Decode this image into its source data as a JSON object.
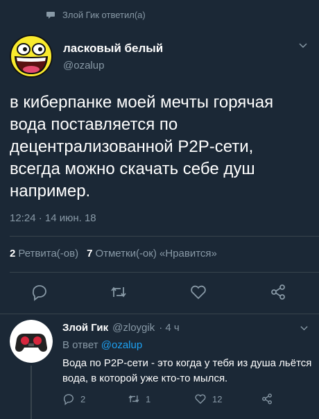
{
  "context": {
    "text": "Злой Гик ответил(а)",
    "icon": "comment-icon"
  },
  "main_tweet": {
    "display_name": "ласковый белый",
    "handle": "@ozalup",
    "text": "в киберпанке моей мечты горячая вода поставляется по децентрализованной P2P-сети, всегда можно скачать себе душ например.",
    "timestamp": "12:24 · 14 июн. 18",
    "retweets_count": "2",
    "retweets_label": "Ретвита(-ов)",
    "likes_count": "7",
    "likes_label": "Отметки(-ок) «Нравится»"
  },
  "reply": {
    "display_name": "Злой Гик",
    "handle": "@zloygik",
    "time": "· 4 ч",
    "reply_to_prefix": "В ответ",
    "reply_to_handle": "@ozalup",
    "text": "Вода по P2P-сети - это когда у тебя из душа льётся вода, в которой уже кто-то мылся.",
    "replies": "2",
    "retweets": "1",
    "likes": "12"
  },
  "colors": {
    "background": "#1b2836",
    "text": "#ffffff",
    "muted": "#8899a6",
    "link": "#1da1f2",
    "divider": "#38444d"
  }
}
